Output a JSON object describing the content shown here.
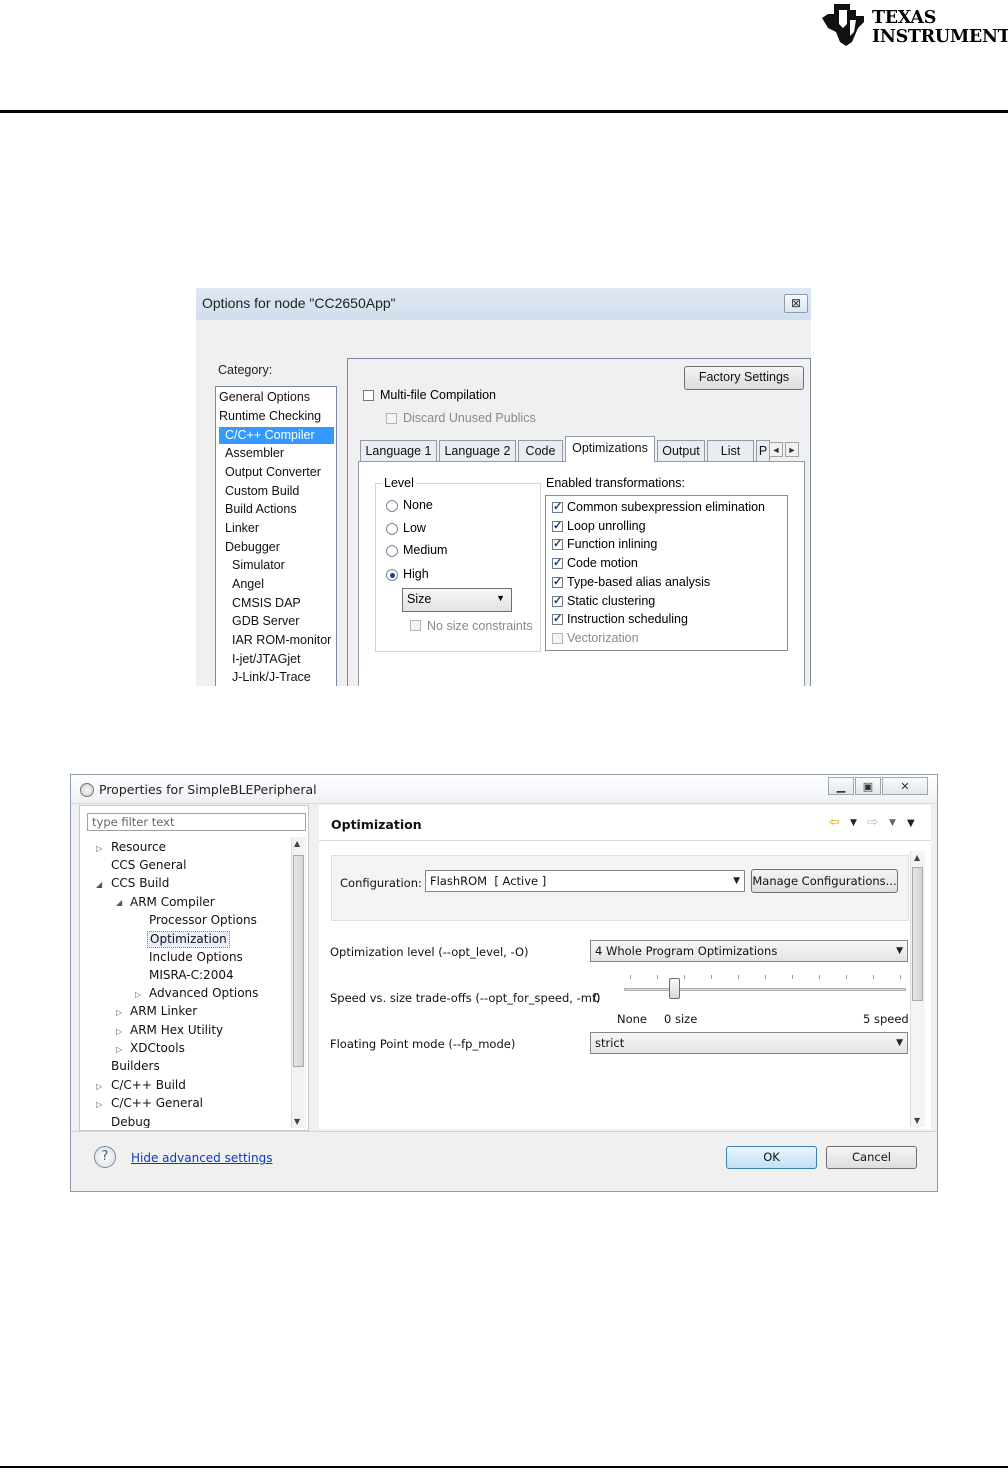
{
  "header": {
    "logo_line1": "Texas",
    "logo_line2": "Instruments"
  },
  "iar": {
    "title": "Options for node \"CC2650App\"",
    "close_glyph": "⊠",
    "category_label": "Category:",
    "categories": [
      "General Options",
      "Runtime Checking",
      "C/C++ Compiler",
      "Assembler",
      "Output Converter",
      "Custom Build",
      "Build Actions",
      "Linker",
      "Debugger",
      "Simulator",
      "Angel",
      "CMSIS DAP",
      "GDB Server",
      "IAR ROM-monitor",
      "I-jet/JTAGjet",
      "J-Link/J-Trace"
    ],
    "selected_category": "C/C++ Compiler",
    "factory_settings": "Factory Settings",
    "multifile": "Multi-file Compilation",
    "discard_unused": "Discard Unused Publics",
    "tabs": [
      "Language 1",
      "Language 2",
      "Code",
      "Optimizations",
      "Output",
      "List",
      "P"
    ],
    "active_tab": "Optimizations",
    "level_group": "Level",
    "levels": [
      "None",
      "Low",
      "Medium",
      "High"
    ],
    "selected_level": "High",
    "size_select": "Size",
    "no_size_constraints": "No size constraints",
    "transformations_label": "Enabled transformations:",
    "transformations": [
      {
        "label": "Common subexpression elimination",
        "checked": true,
        "enabled": true
      },
      {
        "label": "Loop unrolling",
        "checked": true,
        "enabled": true
      },
      {
        "label": "Function inlining",
        "checked": true,
        "enabled": true
      },
      {
        "label": "Code motion",
        "checked": true,
        "enabled": true
      },
      {
        "label": "Type-based alias analysis",
        "checked": true,
        "enabled": true
      },
      {
        "label": "Static clustering",
        "checked": true,
        "enabled": true
      },
      {
        "label": "Instruction scheduling",
        "checked": true,
        "enabled": true
      },
      {
        "label": "Vectorization",
        "checked": false,
        "enabled": false
      }
    ]
  },
  "ccs": {
    "title": "Properties for SimpleBLEPeripheral",
    "filter_placeholder": "type filter text",
    "tree": [
      "Resource",
      "CCS General",
      "CCS Build",
      "ARM Compiler",
      "Processor Options",
      "Optimization",
      "Include Options",
      "MISRA-C:2004",
      "Advanced Options",
      "ARM Linker",
      "ARM Hex Utility",
      "XDCtools",
      "Builders",
      "C/C++ Build",
      "C/C++ General",
      "Debug"
    ],
    "page_heading": "Optimization",
    "config_label": "Configuration:",
    "config_value": "FlashROM  [ Active ]",
    "manage_configs": "Manage Configurations...",
    "opt_level_label": "Optimization level (--opt_level, -O)",
    "opt_level_value": "4 Whole Program Optimizations",
    "speed_label": "Speed vs. size trade-offs (--opt_for_speed, -mf)",
    "speed_value": "0",
    "slider_none": "None",
    "slider_min": "0 size",
    "slider_max": "5 speed",
    "slider_position": 0,
    "fp_label": "Floating Point mode (--fp_mode)",
    "fp_value": "strict",
    "help_link": "Hide advanced settings",
    "ok": "OK",
    "cancel": "Cancel"
  }
}
